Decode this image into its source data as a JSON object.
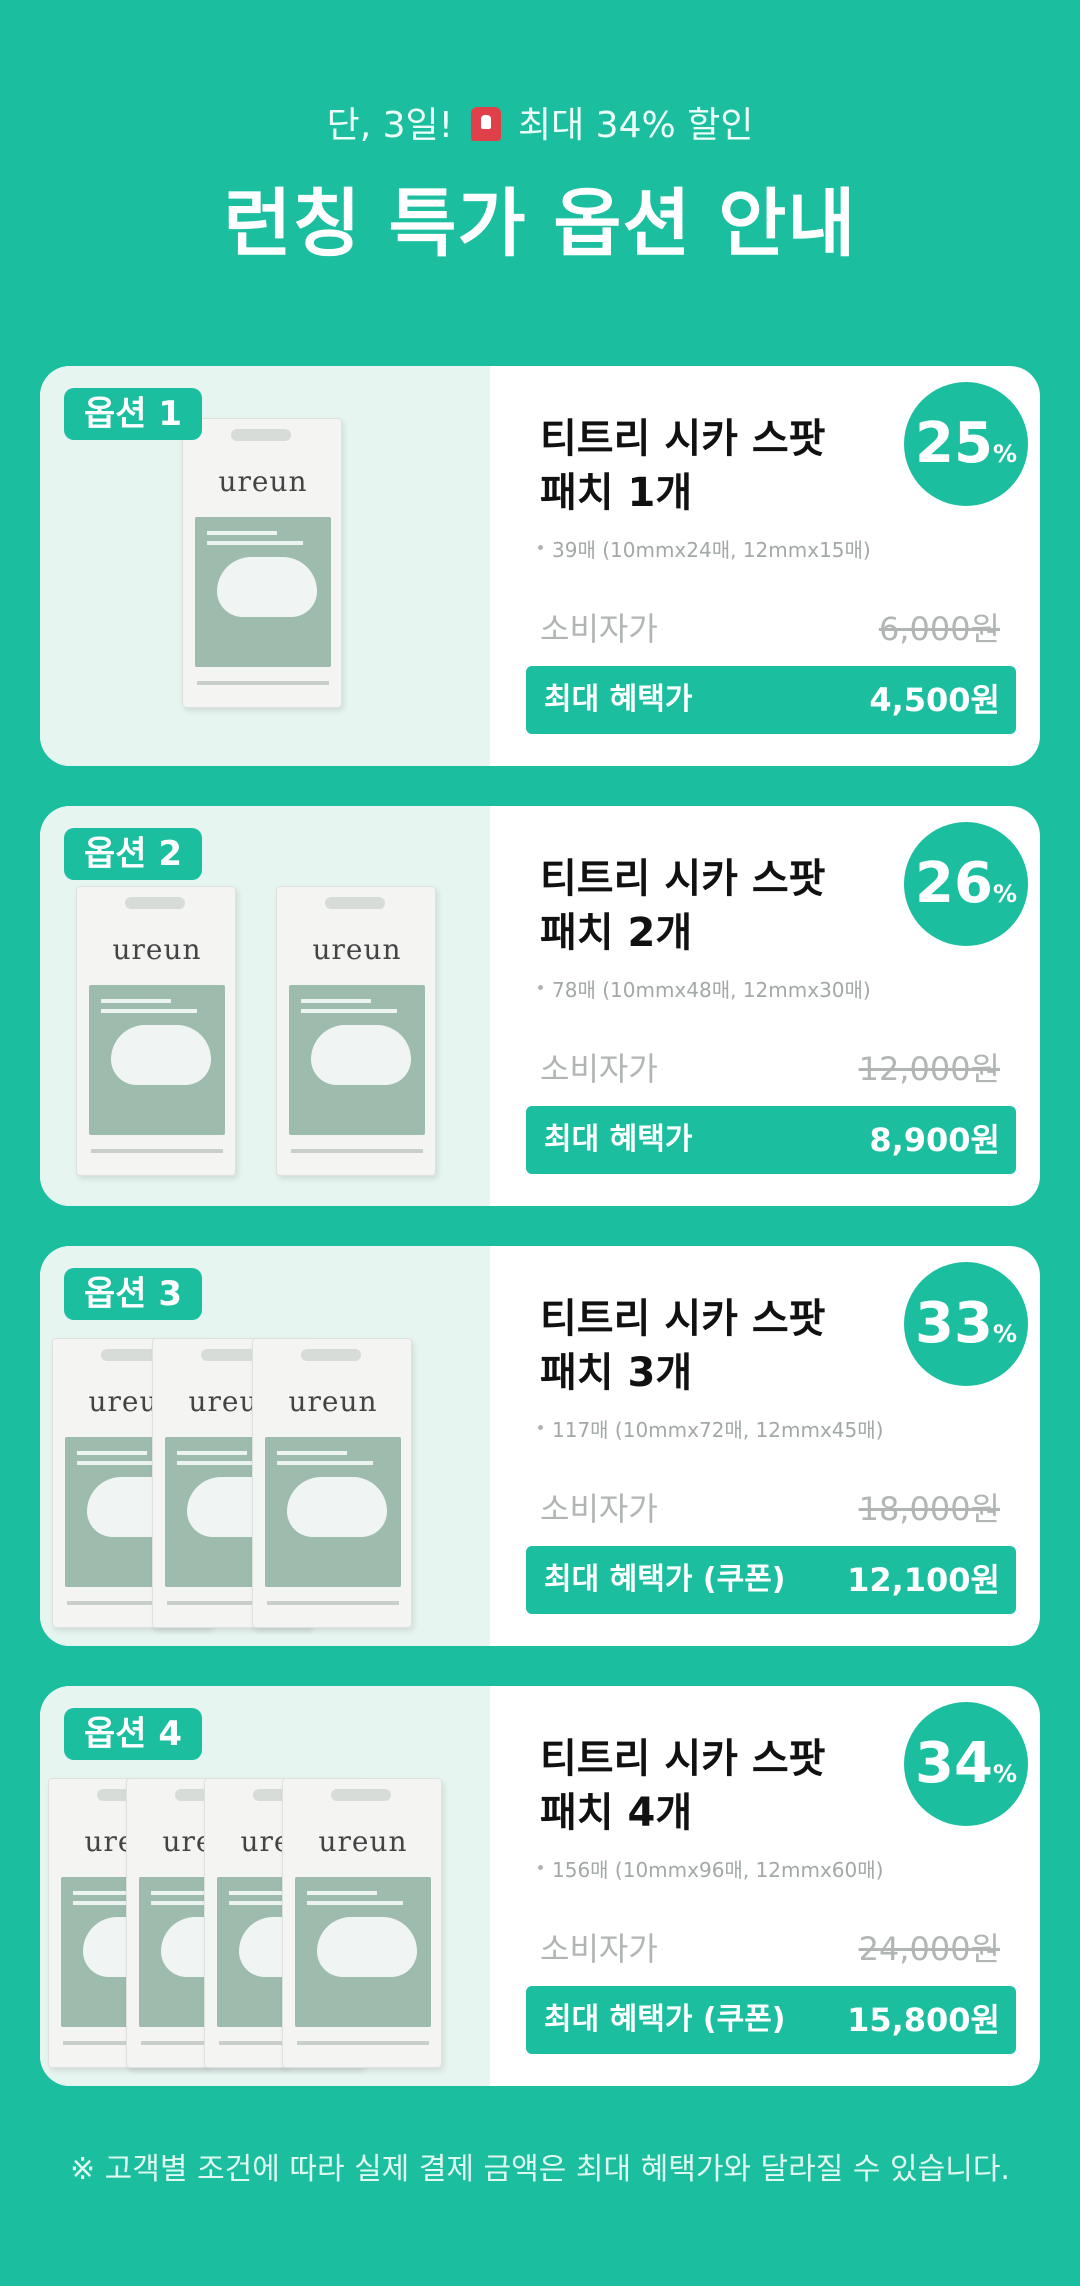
{
  "header": {
    "subtitle_pre": "단, 3일!",
    "subtitle_post": "최대 34% 할인",
    "title": "런칭 특가 옵션 안내"
  },
  "product": {
    "brand": "ureun"
  },
  "options": [
    {
      "tag": "옵션 1",
      "name_line1": "티트리 시카 스팟",
      "name_line2": "패치 1개",
      "spec": "39매 (10mmx24매, 12mmx15매)",
      "percent": "25",
      "percent_unit": "%",
      "consumer_label": "소비자가",
      "consumer_price": "6,000원",
      "benefit_label": "최대 혜택가",
      "benefit_price": "4,500원",
      "box_count": 1
    },
    {
      "tag": "옵션 2",
      "name_line1": "티트리 시카 스팟",
      "name_line2": "패치 2개",
      "spec": "78매 (10mmx48매, 12mmx30매)",
      "percent": "26",
      "percent_unit": "%",
      "consumer_label": "소비자가",
      "consumer_price": "12,000원",
      "benefit_label": "최대 혜택가",
      "benefit_price": "8,900원",
      "box_count": 2
    },
    {
      "tag": "옵션 3",
      "name_line1": "티트리 시카 스팟",
      "name_line2": "패치 3개",
      "spec": "117매 (10mmx72매, 12mmx45매)",
      "percent": "33",
      "percent_unit": "%",
      "consumer_label": "소비자가",
      "consumer_price": "18,000원",
      "benefit_label": "최대 혜택가 (쿠폰)",
      "benefit_price": "12,100원",
      "box_count": 3
    },
    {
      "tag": "옵션 4",
      "name_line1": "티트리 시카 스팟",
      "name_line2": "패치 4개",
      "spec": "156매 (10mmx96매, 12mmx60매)",
      "percent": "34",
      "percent_unit": "%",
      "consumer_label": "소비자가",
      "consumer_price": "24,000원",
      "benefit_label": "최대 혜택가 (쿠폰)",
      "benefit_price": "15,800원",
      "box_count": 4
    }
  ],
  "footer": {
    "note": "※ 고객별 조건에 따라 실제 결제 금액은 최대 혜택가와 달라질 수 있습니다."
  },
  "colors": {
    "accent": "#1bbf9f",
    "card_left_bg": "#e7f5f1",
    "box_panel": "#9dbcae"
  },
  "icons": {
    "siren": "siren-emoji-icon"
  }
}
